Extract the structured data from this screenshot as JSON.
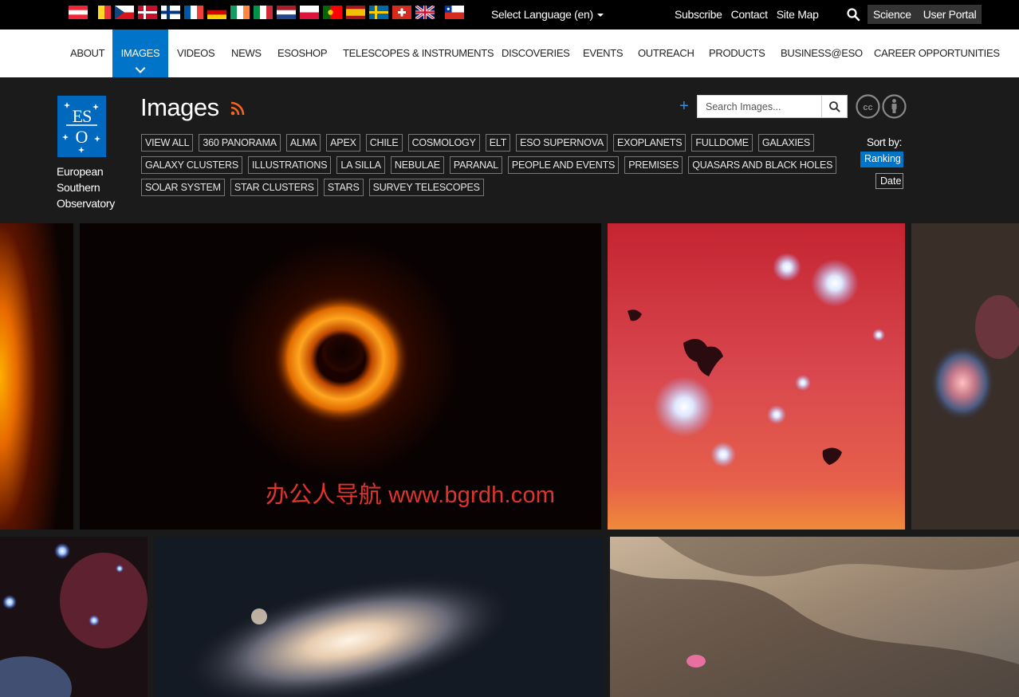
{
  "topbar": {
    "flags": [
      "Austria",
      "Belgium",
      "Czech Republic",
      "Denmark",
      "Finland",
      "France",
      "Germany",
      "Ireland",
      "Italy",
      "Netherlands",
      "Poland",
      "Portugal",
      "Spain",
      "Sweden",
      "Switzerland",
      "United Kingdom",
      "Chile"
    ],
    "select_language": "Select Language (en)",
    "links": [
      "Subscribe",
      "Contact",
      "Site Map"
    ],
    "portal": [
      "Science",
      "User Portal"
    ]
  },
  "nav": {
    "items": [
      "ABOUT",
      "IMAGES",
      "VIDEOS",
      "NEWS",
      "ESOSHOP",
      "TELESCOPES & INSTRUMENTS",
      "DISCOVERIES",
      "EVENTS",
      "OUTREACH",
      "PRODUCTS",
      "BUSINESS@ESO",
      "CAREER OPPORTUNITIES"
    ],
    "active": "IMAGES"
  },
  "header": {
    "org_lines": [
      "European",
      "Southern",
      "Observatory"
    ],
    "title": "Images",
    "search_placeholder": "Search Images...",
    "sort_label": "Sort by:",
    "sort_options": [
      "Ranking",
      "Date"
    ],
    "sort_selected": "Ranking"
  },
  "tags": {
    "row1": [
      "VIEW ALL",
      "360 PANORAMA",
      "ALMA",
      "APEX",
      "CHILE",
      "COSMOLOGY",
      "ELT",
      "ESO SUPERNOVA",
      "EXOPLANETS",
      "FULLDOME",
      "GALAXIES"
    ],
    "row2": [
      "GALAXY CLUSTERS",
      "ILLUSTRATIONS",
      "LA SILLA",
      "NEBULAE",
      "PARANAL",
      "PEOPLE AND EVENTS",
      "PREMISES",
      "QUASARS AND BLACK HOLES"
    ],
    "row3": [
      "SOLAR SYSTEM",
      "STAR CLUSTERS",
      "STARS",
      "SURVEY TELESCOPES"
    ]
  },
  "watermark": "办公人导航  www.bgrdh.com",
  "colors": {
    "accent": "#0074c8",
    "topbar": "#000000",
    "header": "#1b1b1b",
    "watermark": "#e0342c"
  }
}
